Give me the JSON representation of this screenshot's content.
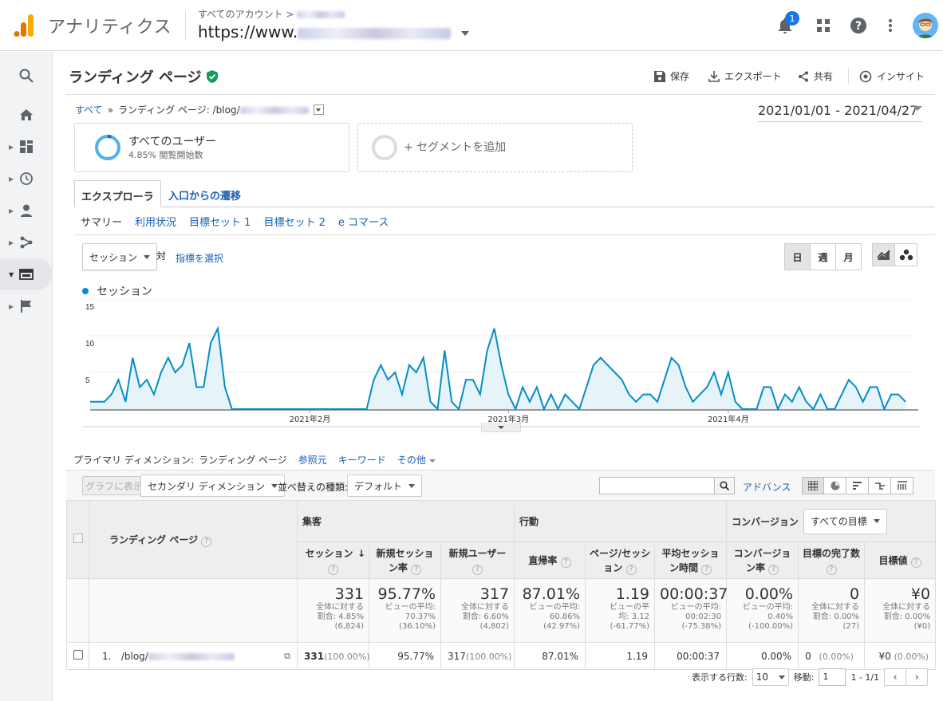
{
  "header": {
    "app_name": "アナリティクス",
    "account_crumb": "すべてのアカウント >",
    "property_url": "https://www.",
    "notification_count": "1"
  },
  "page": {
    "title": "ランディング ページ",
    "actions": {
      "save": "保存",
      "export": "エクスポート",
      "share": "共有",
      "insights": "インサイト"
    }
  },
  "breadcrumb": {
    "all": "すべて",
    "sep": "»",
    "current": "ランディング ページ: /blog/"
  },
  "date_range": "2021/01/01 - 2021/04/27",
  "segments": {
    "all_users": "すべてのユーザー",
    "all_users_sub": "4.85% 閲覧開始数",
    "add_segment": "+ セグメントを追加"
  },
  "tabs": {
    "explorer": "エクスプローラ",
    "entrance_paths": "入口からの遷移"
  },
  "subtabs": [
    "サマリー",
    "利用状況",
    "目標セット 1",
    "目標セット 2",
    "e コマース"
  ],
  "metric_select": {
    "value": "セッション",
    "vs": "対",
    "choose": "指標を選択"
  },
  "granularity": {
    "day": "日",
    "week": "週",
    "month": "月"
  },
  "chart_data": {
    "type": "area",
    "legend": "セッション",
    "color": "#058dc7",
    "yticks": [
      "15",
      "10",
      "5"
    ],
    "ylim": [
      0,
      15
    ],
    "xticks": [
      {
        "label": "2021年2月",
        "index": 31
      },
      {
        "label": "2021年3月",
        "index": 59
      },
      {
        "label": "2021年4月",
        "index": 90
      }
    ],
    "values": [
      1,
      1,
      1,
      2,
      4,
      1,
      7,
      3,
      4,
      2,
      5,
      7,
      5,
      6,
      9,
      3,
      3,
      9,
      11,
      3,
      0,
      0,
      0,
      0,
      0,
      0,
      0,
      0,
      0,
      0,
      0,
      0,
      0,
      0,
      0,
      0,
      0,
      0,
      0,
      0,
      4,
      6,
      4,
      5,
      2,
      6,
      5,
      7,
      1,
      0,
      8,
      1,
      0,
      4,
      4,
      2,
      8,
      11,
      6,
      2,
      0,
      3,
      1,
      3,
      0,
      2,
      0,
      2,
      1,
      0,
      3,
      6,
      7,
      6,
      5,
      4,
      2,
      1,
      2,
      2,
      1,
      4,
      7,
      6,
      3,
      1,
      2,
      3,
      5,
      2,
      5,
      1,
      0,
      0,
      0,
      3,
      3,
      0,
      2,
      1,
      3,
      1,
      0,
      2,
      0,
      0,
      2,
      4,
      3,
      1,
      3,
      3,
      0,
      2,
      2,
      1
    ],
    "note": "daily sessions 2021/01/01 - 2021/04/27 (approximate, read from chart)"
  },
  "dimensions": {
    "label": "プライマリ ディメンション:",
    "current": "ランディング ページ",
    "referrer": "参照元",
    "keyword": "キーワード",
    "other": "その他"
  },
  "toolbar": {
    "plot": "グラフに表示",
    "secondary": "セカンダリ ディメンション",
    "sort_label": "並べ替えの種類:",
    "sort_value": "デフォルト",
    "advanced": "アドバンス"
  },
  "table": {
    "dim_header": "ランディング ページ",
    "groups": {
      "acquisition": "集客",
      "behavior": "行動",
      "conversion": "コンバージョン",
      "goal_select": "すべての目標"
    },
    "columns": [
      "セッション",
      "新規セッション率",
      "新規ユーザー",
      "直帰率",
      "ページ/セッション",
      "平均セッション時間",
      "コンバージョン率",
      "目標の完了数",
      "目標値"
    ],
    "totals": [
      {
        "value": "331",
        "l1": "全体に対する",
        "l2": "割合: 4.85%",
        "l3": "(6,824)"
      },
      {
        "value": "95.77%",
        "l1": "ビューの平均:",
        "l2": "70.37%",
        "l3": "(36.10%)"
      },
      {
        "value": "317",
        "l1": "全体に対する",
        "l2": "割合: 6.60%",
        "l3": "(4,802)"
      },
      {
        "value": "87.01%",
        "l1": "ビューの平均:",
        "l2": "60.86%",
        "l3": "(42.97%)"
      },
      {
        "value": "1.19",
        "l1": "ビューの平",
        "l2": "均: 3.12",
        "l3": "(-61.77%)"
      },
      {
        "value": "00:00:37",
        "l1": "ビューの平均:",
        "l2": "00:02:30",
        "l3": "(-75.38%)"
      },
      {
        "value": "0.00%",
        "l1": "ビューの平均:",
        "l2": "0.40%",
        "l3": "(-100.00%)"
      },
      {
        "value": "0",
        "l1": "全体に対する",
        "l2": "割合: 0.00%",
        "l3": "(27)"
      },
      {
        "value": "¥0",
        "l1": "全体に対する",
        "l2": "割合: 0.00%",
        "l3": "(¥0)"
      }
    ],
    "row": {
      "index": "1.",
      "page": "/blog/",
      "sessions": "331",
      "sessions_pct": "(100.00%)",
      "new_rate": "95.77%",
      "new_users": "317",
      "new_users_pct": "(100.00%)",
      "bounce": "87.01%",
      "pps": "1.19",
      "duration": "00:00:37",
      "conv": "0.00%",
      "goals": "0",
      "goals_pct": "(0.00%)",
      "value": "¥0",
      "value_pct": "(0.00%)"
    }
  },
  "pager": {
    "rows_label": "表示する行数:",
    "rows_value": "10",
    "goto_label": "移動:",
    "goto_value": "1",
    "range": "1 - 1/1"
  }
}
